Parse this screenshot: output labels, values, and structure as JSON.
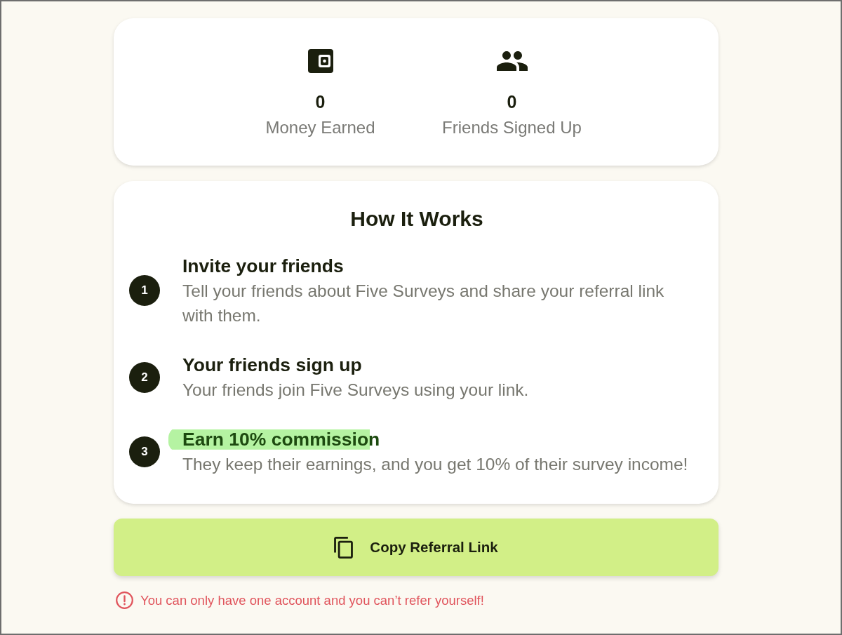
{
  "stats": [
    {
      "kind": "wallet",
      "value": "0",
      "label": "Money Earned"
    },
    {
      "kind": "people",
      "value": "0",
      "label": "Friends Signed Up"
    }
  ],
  "how_it_works": {
    "title": "How It Works",
    "steps": [
      {
        "number": "1",
        "title": "Invite your friends",
        "description": "Tell your friends about Five Surveys and share your referral link with them.",
        "highlighted": false
      },
      {
        "number": "2",
        "title": "Your friends sign up",
        "description": "Your friends join Five Surveys using your link.",
        "highlighted": false
      },
      {
        "number": "3",
        "title": "Earn 10% commission",
        "description": "They keep their earnings, and you get 10% of their survey income!",
        "highlighted": true
      }
    ]
  },
  "copy_button": {
    "label": "Copy Referral Link"
  },
  "warning": "You can only have one account and you can’t refer yourself!"
}
